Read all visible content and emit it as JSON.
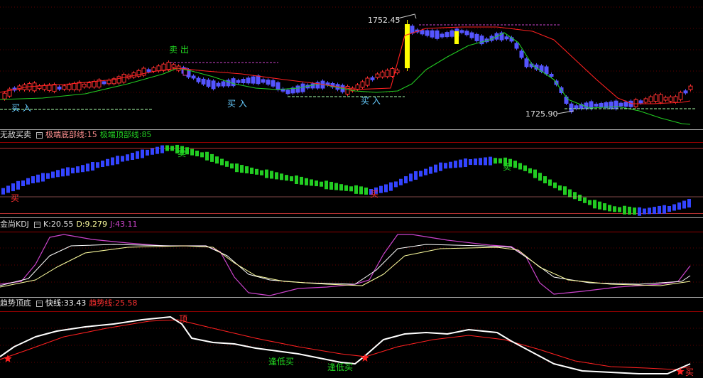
{
  "colors": {
    "up": "#ff3030",
    "down": "#5555ff",
    "yellow": "#ffff00",
    "red": "#ff2020",
    "green": "#22cc22",
    "white": "#ffffff",
    "magenta": "#cc44cc",
    "cream": "#ffffa0",
    "cyan": "#66ccff",
    "pink": "#ff9090",
    "grid": "#800000"
  },
  "panel1": {
    "high_label": "1752.45",
    "low_label": "1725.90",
    "sell_label": "卖 出",
    "buy_label_left": "买 入",
    "buy_label_mid": "买 入",
    "buy_label_right": "买 入"
  },
  "panel2": {
    "title": "无敌买卖",
    "line1_label": "极端底部线:",
    "line1_value": "15",
    "line2_label": "极端顶部线:",
    "line2_value": "85",
    "sell_marks": [
      "卖",
      "卖"
    ],
    "buy_marks": [
      "买",
      "买"
    ]
  },
  "panel3": {
    "title": "金尚KDJ",
    "k_label": "K:",
    "k_value": "20.55",
    "d_label": "D:",
    "d_value": "9.279",
    "j_label": "J:",
    "j_value": "43.11"
  },
  "panel4": {
    "title": "趋势顶底",
    "fast_label": "快线:",
    "fast_value": "33.43",
    "trend_label": "趋势线:",
    "trend_value": "25.58",
    "top_mark": "顶",
    "low_buy_marks": [
      "逢低买",
      "逢低买"
    ],
    "buy_mark": "买"
  },
  "chart_data": [
    {
      "type": "candlestick",
      "panel": "main",
      "price_labels": [
        1752.45,
        1725.9
      ],
      "price_range": [
        1725.9,
        1752.45
      ],
      "markers": [
        "卖 出",
        "买 入",
        "买 入",
        "买 入"
      ]
    },
    {
      "type": "bar",
      "panel": "无敌买卖",
      "reference_lines": [
        15,
        85
      ],
      "bands": "0-100",
      "signals": [
        "卖",
        "卖",
        "买",
        "买"
      ]
    },
    {
      "type": "line",
      "panel": "金尚KDJ",
      "series": [
        {
          "name": "K",
          "last": 20.55
        },
        {
          "name": "D",
          "last": 9.279
        },
        {
          "name": "J",
          "last": 43.11
        }
      ],
      "ylim": [
        0,
        100
      ]
    },
    {
      "type": "line",
      "panel": "趋势顶底",
      "series": [
        {
          "name": "快线",
          "last": 33.43
        },
        {
          "name": "趋势线",
          "last": 25.58
        }
      ],
      "signals": [
        "顶",
        "逢低买",
        "逢低买",
        "买"
      ]
    }
  ]
}
